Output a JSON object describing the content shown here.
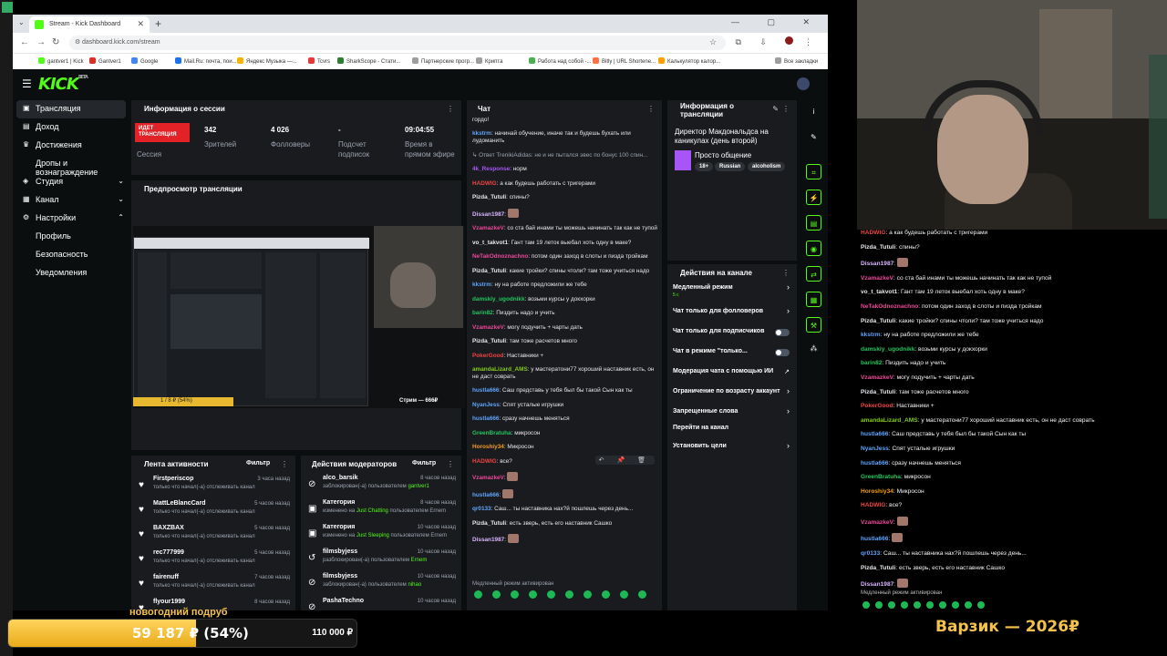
{
  "browser": {
    "tab_title": "Stream - Kick Dashboard",
    "url": "dashboard.kick.com/stream",
    "bookmarks": [
      "gantver1 | Kick",
      "Gantver1",
      "Google",
      "Mail.Ru: почта, пои...",
      "Яндекс Музыка —...",
      "Tcvrs",
      "SharkScope - Стати...",
      "Партнерские прогр...",
      "Крипта",
      "Работа над собой -...",
      "Bitly | URL Shortene...",
      "Калькулятор калор...",
      "Все закладки"
    ]
  },
  "sidebar": {
    "items": [
      {
        "label": "Трансляция",
        "icon": "broadcast-icon"
      },
      {
        "label": "Доход",
        "icon": "wallet-icon"
      },
      {
        "label": "Достижения",
        "icon": "trophy-icon"
      },
      {
        "label": "Дропы и вознаграждение",
        "icon": "gift-icon"
      },
      {
        "label": "Студия",
        "icon": "studio-icon"
      },
      {
        "label": "Канал",
        "icon": "channel-icon"
      },
      {
        "label": "Настройки",
        "icon": "gear-icon"
      },
      {
        "label": "Профиль",
        "icon": ""
      },
      {
        "label": "Безопасность",
        "icon": ""
      },
      {
        "label": "Уведомления",
        "icon": ""
      }
    ]
  },
  "session": {
    "title": "Информация о сессии",
    "badge": "ИДЕТ ТРАНСЛЯЦИЯ",
    "session_label": "Сессия",
    "viewers_value": "342",
    "viewers_label": "Зрителей",
    "followers_value": "4 026",
    "followers_label": "Фолловеры",
    "subs_value": "-",
    "subs_label": "Подсчет подписок",
    "time_value": "09:04:55",
    "time_label": "Время в прямом эфире"
  },
  "preview": {
    "title": "Предпросмотр трансляции",
    "goal_text": "1 / 8 ₽ (54%)",
    "name_text": "Стрим — 666₽"
  },
  "activity": {
    "title": "Лента активности",
    "filter": "Фильтр",
    "items": [
      {
        "name": "Firstperiscop",
        "time": "3 часа назад",
        "desc": "только что начал(-а) отслеживать канал"
      },
      {
        "name": "MattLeBlancCard",
        "time": "5 часов назад",
        "desc": "только что начал(-а) отслеживать канал"
      },
      {
        "name": "BAXZBAX",
        "time": "5 часов назад",
        "desc": "только что начал(-а) отслеживать канал"
      },
      {
        "name": "rec777999",
        "time": "5 часов назад",
        "desc": "только что начал(-а) отслеживать канал"
      },
      {
        "name": "fairenuff",
        "time": "7 часов назад",
        "desc": "только что начал(-а) отслеживать канал"
      },
      {
        "name": "flyour1999",
        "time": "8 часов назад",
        "desc": ""
      }
    ]
  },
  "mods": {
    "title": "Действия модераторов",
    "filter": "Фильтр",
    "items": [
      {
        "name": "alco_barsik",
        "time": "8 часов назад",
        "pre": "заблокирован(-а) пользователем ",
        "hl": "gantver1",
        "post": "",
        "icon": "ban-icon"
      },
      {
        "name": "Категория",
        "time": "8 часов назад",
        "pre": "изменено на ",
        "hl": "Just Chatting",
        "post": " пользователем Ernem",
        "icon": "category-icon"
      },
      {
        "name": "Категория",
        "time": "10 часов назад",
        "pre": "изменено на ",
        "hl": "Just Sleeping",
        "post": " пользователем Ernem",
        "icon": "category-icon"
      },
      {
        "name": "filmsbyjess",
        "time": "10 часов назад",
        "pre": "разблокирован(-а) пользователем ",
        "hl": "Ernem",
        "post": "",
        "icon": "unban-icon"
      },
      {
        "name": "filmsbyjess",
        "time": "10 часов назад",
        "pre": "заблокирован(-а) пользователем ",
        "hl": "nihao",
        "post": "",
        "icon": "ban-icon"
      },
      {
        "name": "PashaTechno",
        "time": "10 часов назад",
        "pre": "",
        "hl": "",
        "post": "",
        "icon": "ban-icon"
      }
    ]
  },
  "chat": {
    "title": "Чат",
    "notice": "Медленный режим активирован",
    "messages": [
      {
        "u": "",
        "c": "#e5e7eb",
        "t": "гордо!"
      },
      {
        "u": "kkstrm",
        "c": "#60a5fa",
        "t": "начинай обучение, иначе так и будешь бухать или лудоманить"
      },
      {
        "u": "",
        "c": "#9ca3af",
        "t": "↳ Ответ TrenikiAdidas: не и не пытался эвес по бонус 100 спин..."
      },
      {
        "u": "4k_Response",
        "c": "#a855f7",
        "t": "норм"
      },
      {
        "u": "HADWIG",
        "c": "#ef4444",
        "t": "а как будешь работать с тригерами"
      },
      {
        "u": "Pizda_Tutuli",
        "c": "#e5e7eb",
        "t": "спины?"
      },
      {
        "u": "Dissan1987",
        "c": "#d8b4fe",
        "t": "",
        "emote": true
      },
      {
        "u": "VzamazkeV",
        "c": "#ec4899",
        "t": "со ста бай инами ты можешь начинать так как не тупой"
      },
      {
        "u": "vo_t_takvot1",
        "c": "#e5e7eb",
        "t": "Гант там 19 леток выебал хоть одну в макe?"
      },
      {
        "u": "NeTakOdnoznachno",
        "c": "#ec4899",
        "t": "потом один заход в слоты и пизда тройкам"
      },
      {
        "u": "Pizda_Tutuli",
        "c": "#e5e7eb",
        "t": "какие тройки? спины чтоли? там тоже учиться надо"
      },
      {
        "u": "kkstrm",
        "c": "#60a5fa",
        "t": "ну на работе предложили же тебе"
      },
      {
        "u": "damskiy_ugodnikk",
        "c": "#22c55e",
        "t": "возьми курсы у докхорки"
      },
      {
        "u": "barin82",
        "c": "#22c55e",
        "t": "Пиздить надо и учить"
      },
      {
        "u": "VzamazkeV",
        "c": "#ec4899",
        "t": "могу подучить + чарты дать"
      },
      {
        "u": "Pizda_Tutuli",
        "c": "#e5e7eb",
        "t": "там тоже расчетов много"
      },
      {
        "u": "PokerGood",
        "c": "#ef4444",
        "t": "Наставники +"
      },
      {
        "u": "amandaLizard_AMS",
        "c": "#84cc16",
        "t": "у мастератони77 хороший наставник есть, он не даст соврать"
      },
      {
        "u": "hustla666",
        "c": "#60a5fa",
        "t": "Саш представь у тебя был бы такой Сын как ты"
      },
      {
        "u": "NyanJess",
        "c": "#60a5fa",
        "t": "Спят усталые игрушки"
      },
      {
        "u": "hustla666",
        "c": "#60a5fa",
        "t": "сразу начнешь меняться"
      },
      {
        "u": "GreenBratuha",
        "c": "#22c55e",
        "t": "микросон"
      },
      {
        "u": "Horoshiy34",
        "c": "#f59e0b",
        "t": "Микросон"
      },
      {
        "u": "HADWIG",
        "c": "#ef4444",
        "t": "все?"
      },
      {
        "u": "VzamazkeV",
        "c": "#ec4899",
        "t": "",
        "emote": true
      },
      {
        "u": "hustla666",
        "c": "#60a5fa",
        "t": "",
        "emote": true
      },
      {
        "u": "qr0133",
        "c": "#60a5fa",
        "t": "Саш... ты наставника нах?й пошлешь через день..."
      },
      {
        "u": "Pizda_Tutuli",
        "c": "#e5e7eb",
        "t": "есть зверь, есть его наставник Сашко"
      },
      {
        "u": "Dissan1987",
        "c": "#d8b4fe",
        "t": "",
        "emote": true
      }
    ]
  },
  "stream_info": {
    "title": "Информация о трансляции",
    "stream_title": "Директор Макдональдса на каникулах (день второй)",
    "category": "Просто общение",
    "tags": [
      "18+",
      "Russian",
      "alcoholism"
    ]
  },
  "channel_actions": {
    "title": "Действия на канале",
    "items": [
      {
        "label": "Медленный режим",
        "sub": "5 с",
        "control": "chevron"
      },
      {
        "label": "Чат только для фолловеров",
        "sub": "",
        "control": "chevron"
      },
      {
        "label": "Чат только для подписчиков",
        "sub": "",
        "control": "toggle"
      },
      {
        "label": "Чат в режиме \"только...",
        "sub": "",
        "control": "toggle"
      },
      {
        "label": "Модерация чата с помощью ИИ",
        "sub": "",
        "control": "external"
      },
      {
        "label": "Ограничение по возрасту аккаунт",
        "sub": "",
        "control": "chevron"
      },
      {
        "label": "Запрещенные слова",
        "sub": "",
        "control": "chevron"
      },
      {
        "label": "Перейти на канал",
        "sub": "",
        "control": "none"
      },
      {
        "label": "Установить цели",
        "sub": "",
        "control": "chevron"
      }
    ]
  },
  "overlay": {
    "title": "Варзик — 2026₽",
    "notice": "Медленный режим активирован",
    "messages": [
      {
        "u": "HADWIG",
        "c": "#ef4444",
        "t": "а как будешь работать с тригерами"
      },
      {
        "u": "Pizda_Tutuli",
        "c": "#e5e7eb",
        "t": "спины?"
      },
      {
        "u": "Dissan1987",
        "c": "#d8b4fe",
        "t": "",
        "emote": true
      },
      {
        "u": "VzamazkeV",
        "c": "#ec4899",
        "t": "со ста бай инами ты можешь начинать так как не тупой"
      },
      {
        "u": "vo_t_takvot1",
        "c": "#e5e7eb",
        "t": "Гант там 19 леток выебал хоть одну в макe?"
      },
      {
        "u": "NeTakOdnoznachno",
        "c": "#ec4899",
        "t": "потом один заход в слоты и пизда тройкам"
      },
      {
        "u": "Pizda_Tutuli",
        "c": "#e5e7eb",
        "t": "какие тройки? спины чтоли? там тоже учиться надо"
      },
      {
        "u": "kkstrm",
        "c": "#60a5fa",
        "t": "ну на работе предложили же тебе"
      },
      {
        "u": "damskiy_ugodnikk",
        "c": "#22c55e",
        "t": "возьми курсы у докхорки"
      },
      {
        "u": "barin82",
        "c": "#22c55e",
        "t": "Пиздить надо и учить"
      },
      {
        "u": "VzamazkeV",
        "c": "#ec4899",
        "t": "могу подучить + чарты дать"
      },
      {
        "u": "Pizda_Tutuli",
        "c": "#e5e7eb",
        "t": "там тоже расчетов много"
      },
      {
        "u": "PokerGood",
        "c": "#ef4444",
        "t": "Наставники +"
      },
      {
        "u": "amandaLizard_AMS",
        "c": "#84cc16",
        "t": "у мастератони77 хороший наставник есть, он не даст соврать"
      },
      {
        "u": "hustla666",
        "c": "#60a5fa",
        "t": "Саш представь у тебя был бы такой Сын как ты"
      },
      {
        "u": "NyanJess",
        "c": "#60a5fa",
        "t": "Спят усталые игрушки"
      },
      {
        "u": "hustla666",
        "c": "#60a5fa",
        "t": "сразу начнешь меняться"
      },
      {
        "u": "GreenBratuha",
        "c": "#22c55e",
        "t": "микросон"
      },
      {
        "u": "Horoshiy34",
        "c": "#f59e0b",
        "t": "Микросон"
      },
      {
        "u": "HADWIG",
        "c": "#ef4444",
        "t": "все?"
      },
      {
        "u": "VzamazkeV",
        "c": "#ec4899",
        "t": "",
        "emote": true
      },
      {
        "u": "hustla666",
        "c": "#60a5fa",
        "t": "",
        "emote": true
      },
      {
        "u": "qr0133",
        "c": "#60a5fa",
        "t": "Саш... ты наставника нах?й пошлешь через день..."
      },
      {
        "u": "Pizda_Tutuli",
        "c": "#e5e7eb",
        "t": "есть зверь, есть его наставник Сашко"
      },
      {
        "u": "Dissan1987",
        "c": "#d8b4fe",
        "t": "",
        "emote": true
      }
    ]
  },
  "donation_goal": {
    "label": "новогодний подруб",
    "current": "59 187 ₽ (54%)",
    "target": "110 000 ₽",
    "progress": 0.54
  },
  "colors": {
    "accent": "#53fc18",
    "live": "#e22226",
    "goal": "#f5c34a"
  }
}
